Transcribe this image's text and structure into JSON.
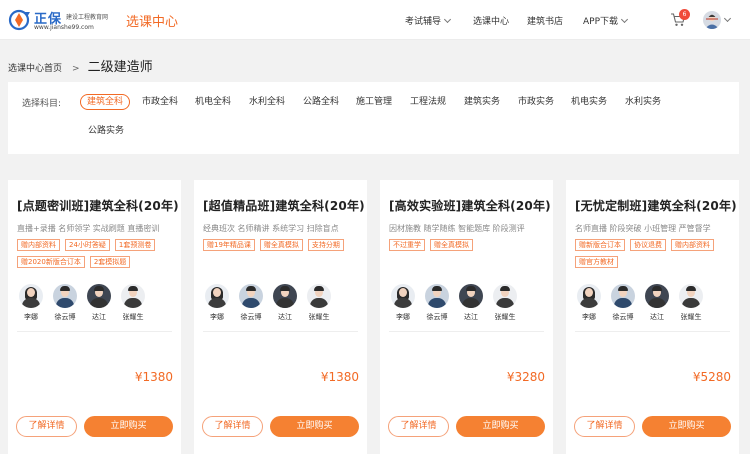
{
  "header": {
    "logo_name": "正保",
    "logo_subtitle": "建设工程教育网",
    "logo_url": "www.jianshe99.com",
    "site_title": "选课中心",
    "nav": [
      {
        "label": "考试辅导",
        "has_dropdown": true
      },
      {
        "label": "选课中心",
        "has_dropdown": false
      },
      {
        "label": "建筑书店",
        "has_dropdown": false
      },
      {
        "label": "APP下载",
        "has_dropdown": true
      }
    ],
    "cart_count": "6",
    "accent_color": "#f26a25"
  },
  "breadcrumb": {
    "home": "选课中心首页",
    "separator": ">",
    "current": "二级建造师"
  },
  "filter": {
    "label": "选择科目:",
    "subjects": [
      "建筑全科",
      "市政全科",
      "机电全科",
      "水利全科",
      "公路全科",
      "施工管理",
      "工程法规",
      "建筑实务",
      "市政实务",
      "机电实务",
      "水利实务",
      "公路实务"
    ],
    "selected": "建筑全科"
  },
  "courses": [
    {
      "title": "[点题密训班]建筑全科(20年)",
      "desc": "直播+录播 名师领学 实战刷题 直播密训",
      "badges": [
        "赠内部资料",
        "24小时答疑",
        "1套预测卷",
        "赠2020新版合订本",
        "2套模拟题"
      ],
      "teachers": [
        "李娜",
        "徐云博",
        "达江",
        "张耀生"
      ],
      "price": "¥1380",
      "detail_label": "了解详情",
      "buy_label": "立即购买"
    },
    {
      "title": "[超值精品班]建筑全科(20年)",
      "desc": "经典班次 名师精讲 系统学习 扫除盲点",
      "badges": [
        "赠19年精品课",
        "赠全真模拟",
        "支持分期"
      ],
      "teachers": [
        "李娜",
        "徐云博",
        "达江",
        "张耀生"
      ],
      "price": "¥1380",
      "detail_label": "了解详情",
      "buy_label": "立即购买"
    },
    {
      "title": "[高效实验班]建筑全科(20年)",
      "desc": "因材施教 随学随练 智能题库 阶段测评",
      "badges": [
        "不过重学",
        "赠全真模拟"
      ],
      "teachers": [
        "李娜",
        "徐云博",
        "达江",
        "张耀生"
      ],
      "price": "¥3280",
      "detail_label": "了解详情",
      "buy_label": "立即购买"
    },
    {
      "title": "[无忧定制班]建筑全科(20年)",
      "desc": "名师直播 阶段突破 小班管理 严管督学",
      "badges": [
        "赠新版合订本",
        "协议退费",
        "赠内部资料",
        "赠官方教材"
      ],
      "teachers": [
        "李娜",
        "徐云博",
        "达江",
        "张耀生"
      ],
      "price": "¥5280",
      "detail_label": "了解详情",
      "buy_label": "立即购买"
    }
  ]
}
